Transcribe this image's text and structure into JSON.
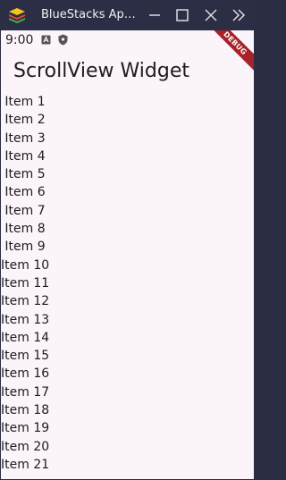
{
  "window": {
    "title": "BlueStacks Ap…",
    "logo_icon": "bluestacks-logo-icon",
    "controls": [
      "minimize-icon",
      "maximize-icon",
      "close-icon",
      "expand-panel-icon"
    ]
  },
  "statusbar": {
    "time": "9:00",
    "icons": [
      "notification-a-icon",
      "shield-icon"
    ]
  },
  "appbar": {
    "title": "ScrollView Widget"
  },
  "debug_banner": "DEBUG",
  "list": {
    "items": [
      "Item 1",
      "Item 2",
      "Item 3",
      "Item 4",
      "Item 5",
      "Item 6",
      "Item 7",
      "Item 8",
      "Item 9",
      "Item 10",
      "Item 11",
      "Item 12",
      "Item 13",
      "Item 14",
      "Item 15",
      "Item 16",
      "Item 17",
      "Item 18",
      "Item 19",
      "Item 20",
      "Item 21"
    ]
  },
  "colors": {
    "titlebar": "#2c2e45",
    "background": "#fcf4fb",
    "text": "#1d1b20",
    "debug_banner": "#a4242a"
  }
}
